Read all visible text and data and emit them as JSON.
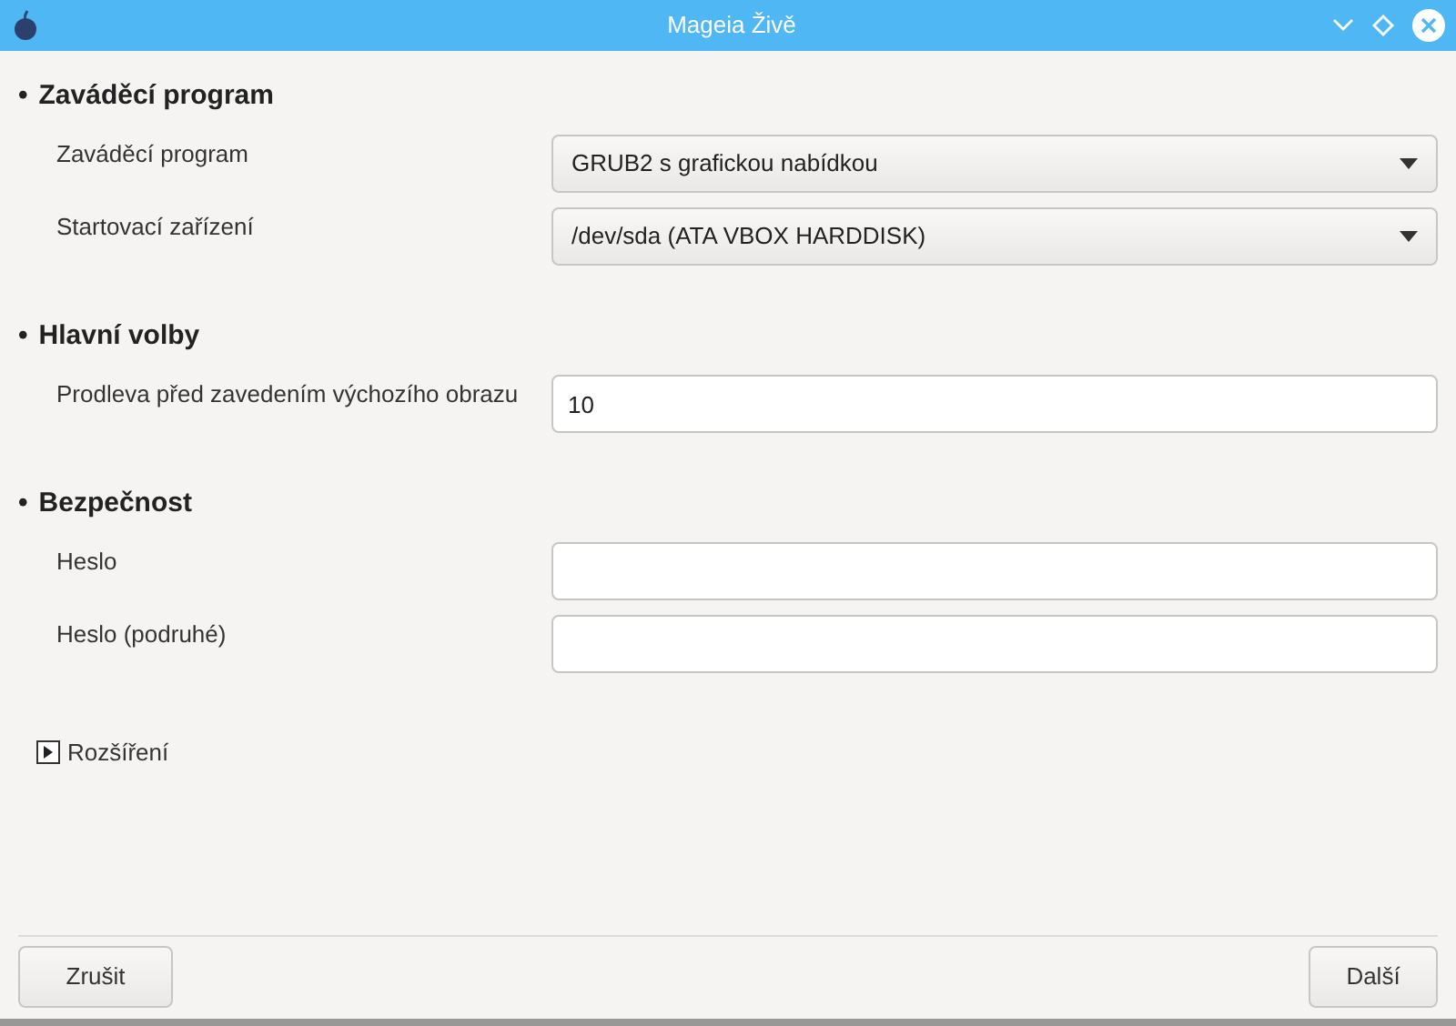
{
  "window": {
    "title": "Mageia Živě"
  },
  "sections": [
    {
      "bullet": "•",
      "title": "Zaváděcí program",
      "rows": [
        {
          "label": "Zaváděcí program",
          "kind": "dropdown",
          "value": "GRUB2 s grafickou nabídkou"
        },
        {
          "label": "Startovací zařízení",
          "kind": "dropdown",
          "value": "/dev/sda (ATA VBOX HARDDISK)"
        }
      ]
    },
    {
      "bullet": "•",
      "title": "Hlavní volby",
      "rows": [
        {
          "label": "Prodleva před zavedením výchozího obrazu",
          "kind": "input",
          "value": "10"
        }
      ]
    },
    {
      "bullet": "•",
      "title": "Bezpečnost",
      "rows": [
        {
          "label": "Heslo",
          "kind": "input"
        },
        {
          "label": "Heslo (podruhé)",
          "kind": "input"
        }
      ]
    }
  ],
  "expander": {
    "label": "Rozšíření",
    "expanded": false
  },
  "buttons": {
    "cancel": "Zrušit",
    "next": "Další"
  }
}
